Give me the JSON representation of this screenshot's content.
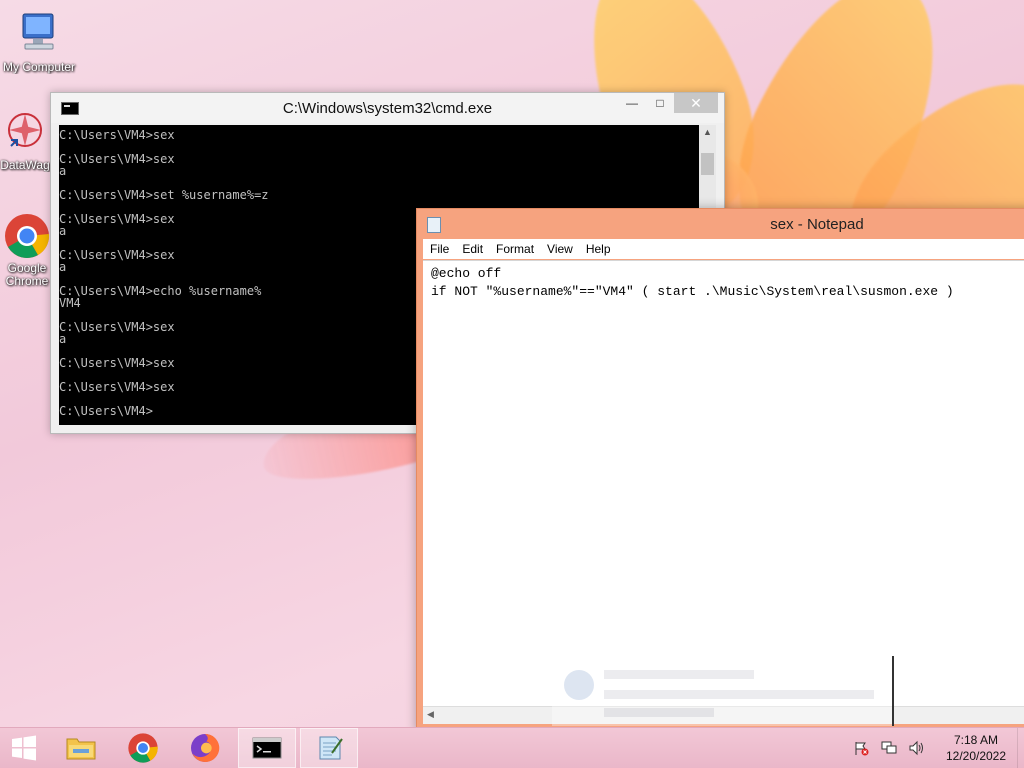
{
  "desktop": {
    "icons": [
      {
        "label": "My Computer"
      },
      {
        "label": "DataWag"
      },
      {
        "label": "Google Chrome"
      }
    ]
  },
  "cmd": {
    "title": "C:\\Windows\\system32\\cmd.exe",
    "lines": "C:\\Users\\VM4>sex\n\nC:\\Users\\VM4>sex\na\n\nC:\\Users\\VM4>set %username%=z\n\nC:\\Users\\VM4>sex\na\n\nC:\\Users\\VM4>sex\na\n\nC:\\Users\\VM4>echo %username%\nVM4\n\nC:\\Users\\VM4>sex\na\n\nC:\\Users\\VM4>sex\n\nC:\\Users\\VM4>sex\n\nC:\\Users\\VM4>"
  },
  "notepad": {
    "title": "sex - Notepad",
    "menu": [
      "File",
      "Edit",
      "Format",
      "View",
      "Help"
    ],
    "content": "@echo off\nif NOT \"%username%\"==\"VM4\" ( start .\\Music\\System\\real\\susmon.exe )"
  },
  "taskbar": {
    "time": "7:18 AM",
    "date": "12/20/2022"
  },
  "colors": {
    "notepad_frame": "#f6a37f",
    "cmd_background": "#000000",
    "cmd_text": "#c0c0c0",
    "taskbar": "#f0c2d2"
  }
}
